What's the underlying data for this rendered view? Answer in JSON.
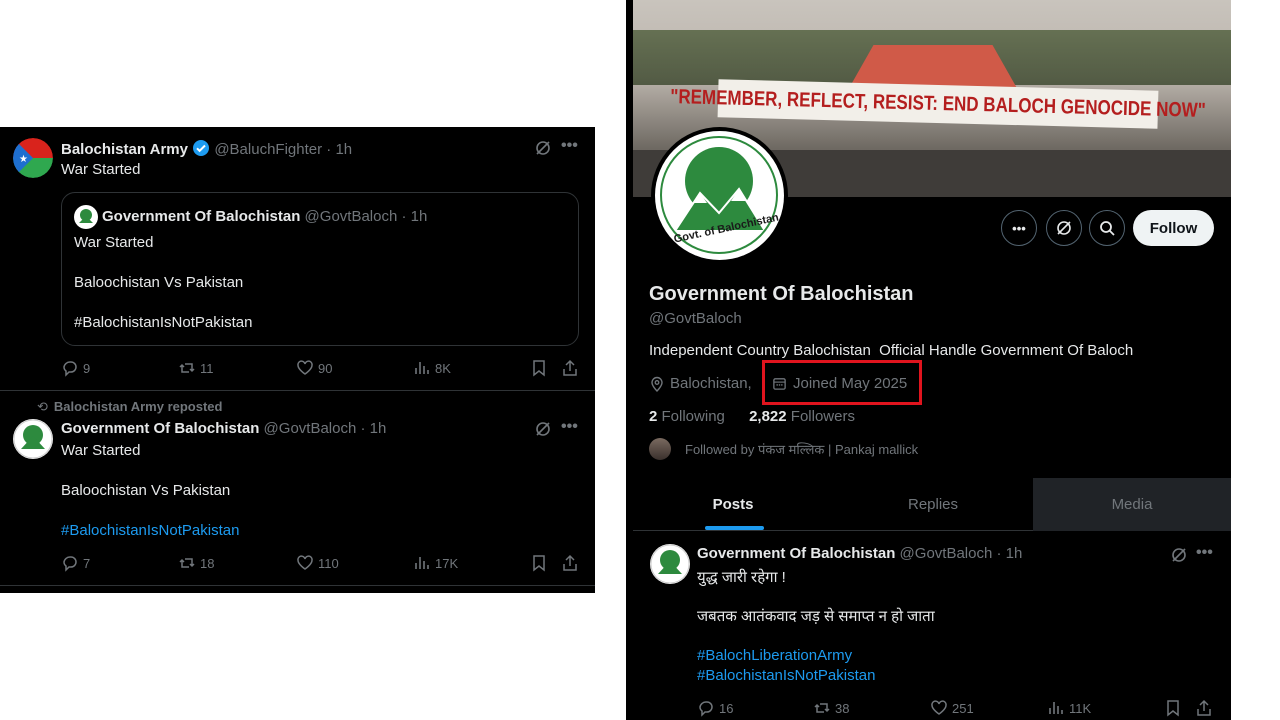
{
  "left_feed": {
    "tweet1": {
      "name": "Balochistan Army",
      "handle": "@BaluchFighter",
      "time": "· 1h",
      "text": "War Started",
      "quote": {
        "name": "Government Of Balochistan",
        "handle": "@GovtBaloch",
        "time": "· 1h",
        "lines": [
          "War Started",
          "Baloochistan Vs Pakistan",
          "#BalochistanIsNotPakistan"
        ]
      },
      "stats": {
        "replies": "9",
        "reposts": "11",
        "likes": "90",
        "views": "8K"
      }
    },
    "tweet2": {
      "repost_label": "Balochistan Army reposted",
      "name": "Government Of Balochistan",
      "handle": "@GovtBaloch",
      "time": "· 1h",
      "lines": [
        "War Started",
        "Baloochistan Vs Pakistan",
        "#BalochistanIsNotPakistan"
      ],
      "stats": {
        "replies": "7",
        "reposts": "18",
        "likes": "110",
        "views": "17K"
      }
    }
  },
  "profile": {
    "banner_text": "\"REMEMBER, REFLECT, RESIST: END BALOCH GENOCIDE NOW\"",
    "avatar_text": "Govt. of Balochistan",
    "follow_label": "Follow",
    "name": "Government Of Balochistan",
    "handle": "@GovtBaloch",
    "bio": "Independent Country Balochistan  Official Handle Government Of Baloch",
    "location": "Balochistan,",
    "joined": "Joined May 2025",
    "following_count": "2",
    "following_label": "Following",
    "followers_count": "2,822",
    "followers_label": "Followers",
    "followed_by": "Followed by पंकज मल्लिक | Pankaj mallick",
    "tabs": [
      "Posts",
      "Replies",
      "Media"
    ],
    "tweet": {
      "name": "Government Of Balochistan",
      "handle": "@GovtBaloch",
      "time": "· 1h",
      "line1": "युद्ध जारी रहेगा !",
      "line2": "जबतक आतंकवाद जड़ से समाप्त न हो जाता",
      "tag1": "#BalochLiberationArmy",
      "tag2": "#BalochistanIsNotPakistan",
      "stats": {
        "replies": "16",
        "reposts": "38",
        "likes": "251",
        "views": "11K"
      }
    }
  },
  "colors": {
    "background": "#000000",
    "accent": "#1d9bf0",
    "highlight_box": "#e0141e",
    "verified": "#1d9bf0"
  }
}
